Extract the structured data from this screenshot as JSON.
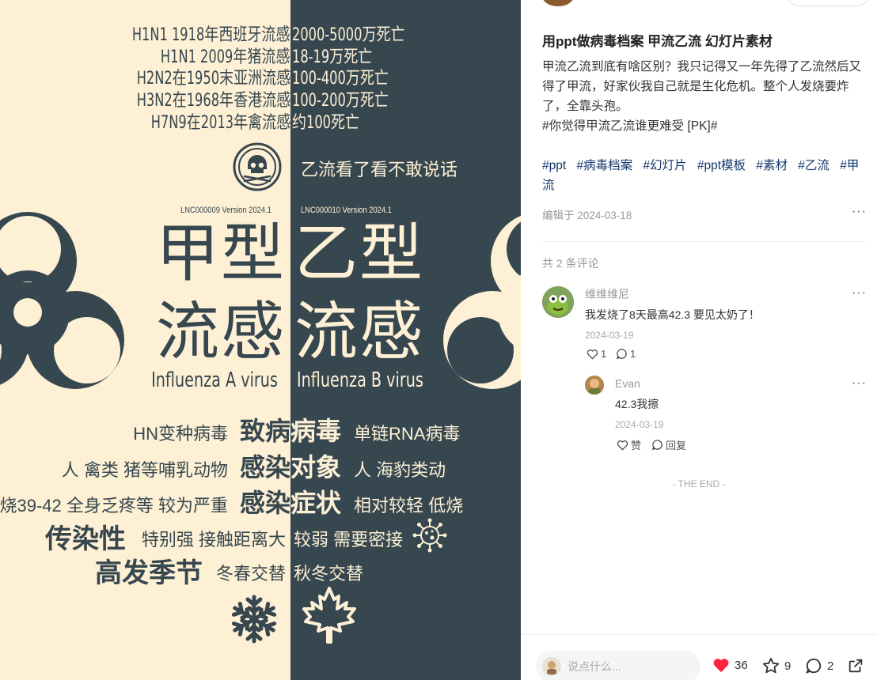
{
  "poster": {
    "history": [
      {
        "left": "H1N1 1918年西班牙流感",
        "right": "2000-5000万死亡"
      },
      {
        "left": "H1N1 2009年猪流感",
        "right": "18-19万死亡"
      },
      {
        "left": "H2N2在1950末亚洲流感",
        "right": "100-400万死亡"
      },
      {
        "left": "H3N2在1968年香港流感",
        "right": "100-200万死亡"
      },
      {
        "left": "H7N9在2013年禽流感",
        "right": "约100死亡"
      }
    ],
    "b_caption": "乙流看了看不敢说话",
    "version_left": "LNC000009  Version 2024.1",
    "version_right": "LNC000010  Version 2024.1",
    "type_a_1": "甲型",
    "type_a_2": "流感",
    "type_b_1": "乙型",
    "type_b_2": "流感",
    "virus_a": "Influenza A virus",
    "virus_b": "Influenza B virus",
    "rows": {
      "r1_left": "HN变种病毒",
      "r1_mid_l": "致病",
      "r1_mid_r": "病毒",
      "r1_right": "单链RNA病毒",
      "r2_left": "人 禽类 猪等哺乳动物",
      "r2_mid_l": "感染",
      "r2_mid_r": "对象",
      "r2_right": "人 海豹类动",
      "r3_left": "烧39-42 全身乏疼等 较为严重",
      "r3_mid_l": "感染",
      "r3_mid_r": "症状",
      "r3_right": "相对较轻 低烧",
      "r4_head": "传染性",
      "r4_left": "特别强 接触距离大",
      "r4_right": "较弱 需要密接",
      "r5_head": "高发季节",
      "r5_left": "冬春交替",
      "r5_right": "秋冬交替"
    },
    "icons": [
      "skull-icon",
      "biohazard-icon",
      "virus-icon",
      "snowflake-icon",
      "maple-leaf-icon"
    ],
    "colors": {
      "cream": "#fdf0d5",
      "slate": "#37474f"
    }
  },
  "post": {
    "title": "用ppt做病毒档案 甲流乙流 幻灯片素材",
    "description": "甲流乙流到底有啥区别？我只记得又一年先得了乙流然后又得了甲流，好家伙我自己就是生化危机。整个人发烧要炸了，全靠头孢。",
    "topic": "#你觉得甲流乙流谁更难受 [PK]#",
    "tags": [
      "#ppt",
      "#病毒档案",
      "#幻灯片",
      "#ppt模板",
      "#素材",
      "#乙流",
      "#甲流"
    ],
    "edited": "编辑于 2024-03-18",
    "more": "···"
  },
  "comments": {
    "count_label": "共 2 条评论",
    "items": [
      {
        "name": "维维维尼",
        "text": "我发烧了8天最高42.3 要见太奶了！",
        "date": "2024-03-19",
        "likes": "1",
        "replies": "1"
      },
      {
        "name": "Evan",
        "text": "42.3我擦",
        "date": "2024-03-19",
        "like_label": "赞",
        "reply_label": "回复"
      }
    ],
    "end": "- THE END -"
  },
  "bottom": {
    "placeholder": "说点什么...",
    "likes": "36",
    "stars": "9",
    "comments": "2",
    "like_color": "#ff2442"
  }
}
